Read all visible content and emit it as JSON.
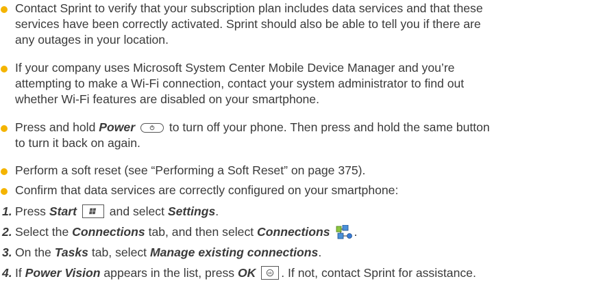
{
  "colors": {
    "bullet": "#f4b400",
    "text": "#3a3a3a"
  },
  "bullets": [
    {
      "lines": [
        "Contact Sprint to verify that your subscription plan includes data services and that these",
        "services have been correctly activated. Sprint should also be able to tell you if there are",
        "any outages in your location."
      ]
    },
    {
      "lines": [
        "If your company uses Microsoft System Center Mobile Device Manager and you’re",
        "attempting to make a Wi-Fi connection, contact your system administrator to find out",
        "whether Wi-Fi features are disabled on your smartphone."
      ]
    },
    {
      "pre": "Press and hold ",
      "bold": "Power",
      "post": " to turn off your phone. Then press and hold the same button",
      "line2": "to turn it back on again.",
      "icon": "power-key-icon"
    },
    {
      "lines": [
        "Perform a soft reset (see “Performing a Soft Reset” on page 375)."
      ]
    },
    {
      "lines": [
        "Confirm that data services are correctly configured on your smartphone:"
      ]
    }
  ],
  "steps": [
    {
      "num": "1.",
      "pre": "Press ",
      "b1": "Start",
      "mid": " and select ",
      "b2": "Settings",
      "post": ".",
      "icon": "start-key-icon"
    },
    {
      "num": "2.",
      "pre": "Select the ",
      "b1": "Connections",
      "mid": " tab, and then select ",
      "b2": "Connections",
      "post": ".",
      "icon": "connections-icon"
    },
    {
      "num": "3.",
      "pre": "On the ",
      "b1": "Tasks",
      "mid": " tab, select ",
      "b2": "Manage existing connections",
      "post": "."
    },
    {
      "num": "4.",
      "pre": "If ",
      "b1": "Power Vision",
      "mid": " appears in the list, press ",
      "b2": "OK",
      "post": ". If not, contact Sprint for assistance.",
      "icon": "ok-key-icon"
    }
  ]
}
